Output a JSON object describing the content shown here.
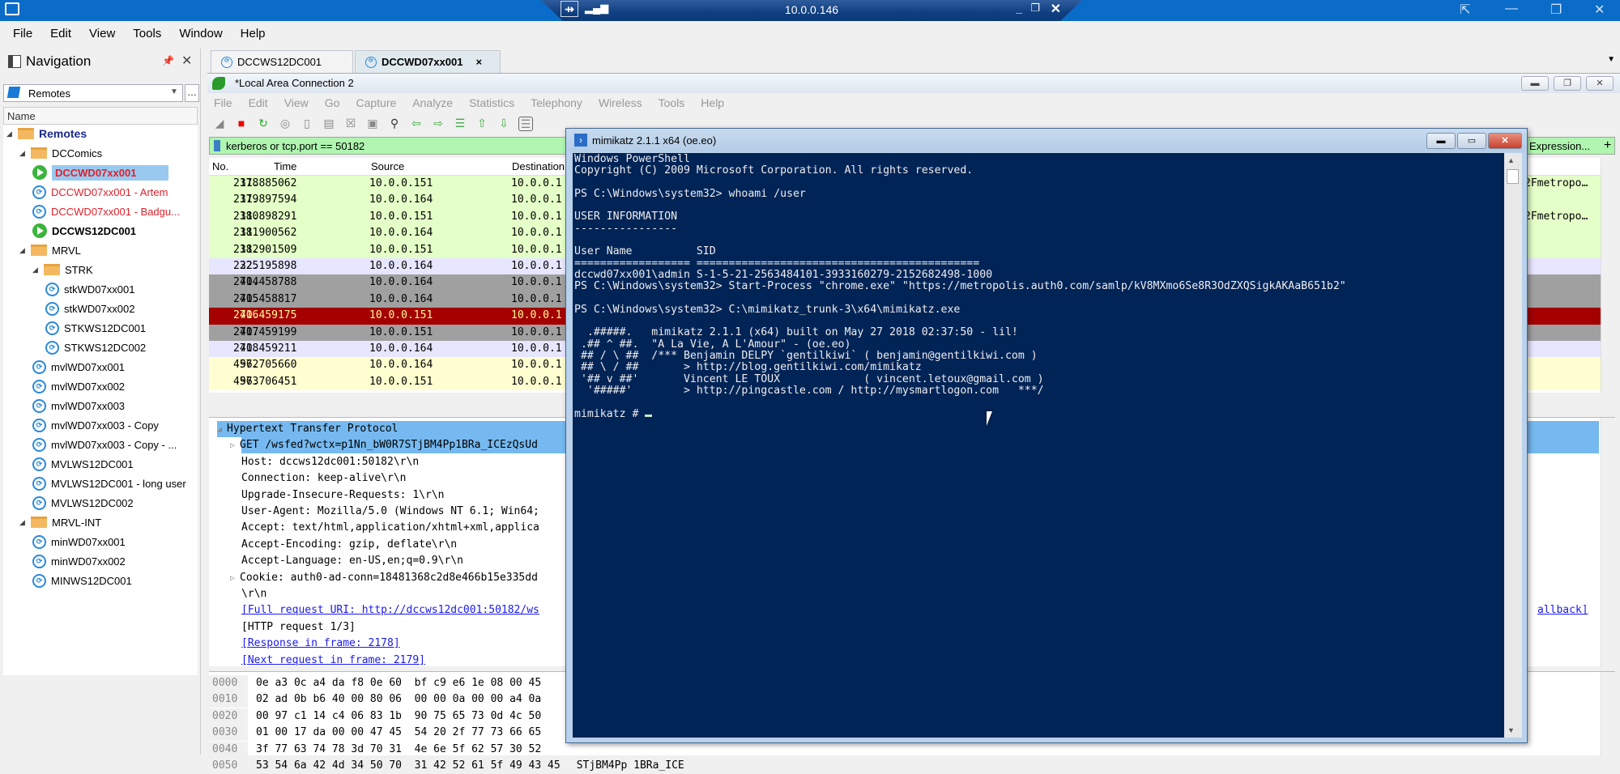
{
  "rdp_bar": {
    "title": "10.0.0.146",
    "pin_icon": "pin-icon",
    "signal_icon": "signal-bars-icon"
  },
  "app": {
    "menu": [
      "File",
      "Edit",
      "View",
      "Tools",
      "Window",
      "Help"
    ]
  },
  "navigation": {
    "title": "Navigation",
    "selector_value": "Remotes",
    "column_header": "Name",
    "tree": [
      {
        "label": "Remotes",
        "type": "root-folder",
        "level": 0,
        "style": "bold navy"
      },
      {
        "label": "DCComics",
        "type": "folder",
        "level": 1
      },
      {
        "label": "DCCWD07xx001",
        "type": "connected",
        "level": 2,
        "style": "bold red",
        "selected": true
      },
      {
        "label": "DCCWD07xx001 - Artem",
        "type": "rdp",
        "level": 2,
        "style": "red"
      },
      {
        "label": "DCCWD07xx001 - Badgu...",
        "type": "rdp",
        "level": 2,
        "style": "red"
      },
      {
        "label": "DCCWS12DC001",
        "type": "connected",
        "level": 2,
        "style": "bold"
      },
      {
        "label": "MRVL",
        "type": "folder",
        "level": 1
      },
      {
        "label": "STRK",
        "type": "folder",
        "level": 2
      },
      {
        "label": "stkWD07xx001",
        "type": "rdp",
        "level": 3
      },
      {
        "label": "stkWD07xx002",
        "type": "rdp",
        "level": 3
      },
      {
        "label": "STKWS12DC001",
        "type": "rdp",
        "level": 3
      },
      {
        "label": "STKWS12DC002",
        "type": "rdp",
        "level": 3
      },
      {
        "label": "mvlWD07xx001",
        "type": "rdp",
        "level": 2
      },
      {
        "label": "mvlWD07xx002",
        "type": "rdp",
        "level": 2
      },
      {
        "label": "mvlWD07xx003",
        "type": "rdp",
        "level": 2
      },
      {
        "label": "mvlWD07xx003 - Copy",
        "type": "rdp",
        "level": 2
      },
      {
        "label": "mvlWD07xx003 - Copy - ...",
        "type": "rdp",
        "level": 2
      },
      {
        "label": "MVLWS12DC001",
        "type": "rdp",
        "level": 2
      },
      {
        "label": "MVLWS12DC001 - long user",
        "type": "rdp",
        "level": 2
      },
      {
        "label": "MVLWS12DC002",
        "type": "rdp",
        "level": 2
      },
      {
        "label": "MRVL-INT",
        "type": "folder",
        "level": 1
      },
      {
        "label": "minWD07xx001",
        "type": "rdp",
        "level": 2
      },
      {
        "label": "minWD07xx002",
        "type": "rdp",
        "level": 2
      },
      {
        "label": "MINWS12DC001",
        "type": "rdp",
        "level": 2
      }
    ]
  },
  "doc_tabs": [
    {
      "label": "DCCWS12DC001",
      "active": false
    },
    {
      "label": "DCCWD07xx001",
      "active": true,
      "close": "×"
    }
  ],
  "wireshark": {
    "title": "*Local Area Connection 2",
    "menu": [
      "File",
      "Edit",
      "View",
      "Go",
      "Capture",
      "Analyze",
      "Statistics",
      "Telephony",
      "Wireless",
      "Tools",
      "Help"
    ],
    "filter": "kerberos or tcp.port == 50182",
    "expression_label": "Expression...",
    "add_label": "+",
    "columns": [
      "No.",
      "Time",
      "Source",
      "Destination"
    ],
    "packets": [
      {
        "no": "2178",
        "time": "31.885062",
        "src": "10.0.0.151",
        "dst": "10.0.0.1",
        "color": "green",
        "extra": "2Fmetropo…"
      },
      {
        "no": "2179",
        "time": "31.897594",
        "src": "10.0.0.164",
        "dst": "10.0.0.1",
        "color": "green",
        "extra": ""
      },
      {
        "no": "2180",
        "time": "31.898291",
        "src": "10.0.0.151",
        "dst": "10.0.0.1",
        "color": "green",
        "extra": "2Fmetropo…"
      },
      {
        "no": "2181",
        "time": "31.900562",
        "src": "10.0.0.164",
        "dst": "10.0.0.1",
        "color": "green",
        "extra": ""
      },
      {
        "no": "2182",
        "time": "31.901509",
        "src": "10.0.0.151",
        "dst": "10.0.0.1",
        "color": "green",
        "extra": ""
      },
      {
        "no": "2225",
        "time": "32.195898",
        "src": "10.0.0.164",
        "dst": "10.0.0.1",
        "color": "lav",
        "extra": ""
      },
      {
        "no": "2714",
        "time": "40.458788",
        "src": "10.0.0.164",
        "dst": "10.0.0.1",
        "color": "gray",
        "extra": ""
      },
      {
        "no": "2715",
        "time": "40.458817",
        "src": "10.0.0.164",
        "dst": "10.0.0.1",
        "color": "gray",
        "extra": ""
      },
      {
        "no": "2716",
        "time": "40.459175",
        "src": "10.0.0.151",
        "dst": "10.0.0.1",
        "color": "red",
        "extra": ""
      },
      {
        "no": "2717",
        "time": "40.459199",
        "src": "10.0.0.151",
        "dst": "10.0.0.1",
        "color": "gray",
        "extra": ""
      },
      {
        "no": "2718",
        "time": "40.459211",
        "src": "10.0.0.164",
        "dst": "10.0.0.1",
        "color": "lav",
        "extra": ""
      },
      {
        "no": "4572",
        "time": "96.705660",
        "src": "10.0.0.164",
        "dst": "10.0.0.1",
        "color": "yel",
        "extra": ""
      },
      {
        "no": "4573",
        "time": "96.706451",
        "src": "10.0.0.151",
        "dst": "10.0.0.1",
        "color": "yel",
        "extra": ""
      }
    ],
    "details": [
      {
        "text": "Hypertext Transfer Protocol",
        "indent": 0,
        "expander": "◢",
        "selected": true
      },
      {
        "text": "GET /wsfed?wctx=p1Nn_bW0R7STjBM4Pp1BRa_ICEzQsUd",
        "indent": 1,
        "expander": "▷",
        "selected": true
      },
      {
        "text": "Host: dccws12dc001:50182\\r\\n",
        "indent": 1
      },
      {
        "text": "Connection: keep-alive\\r\\n",
        "indent": 1
      },
      {
        "text": "Upgrade-Insecure-Requests: 1\\r\\n",
        "indent": 1
      },
      {
        "text": "User-Agent: Mozilla/5.0 (Windows NT 6.1; Win64;",
        "indent": 1
      },
      {
        "text": "Accept: text/html,application/xhtml+xml,applica",
        "indent": 1
      },
      {
        "text": "Accept-Encoding: gzip, deflate\\r\\n",
        "indent": 1
      },
      {
        "text": "Accept-Language: en-US,en;q=0.9\\r\\n",
        "indent": 1
      },
      {
        "text": "Cookie: auth0-ad-conn=18481368c2d8e466b15e335dd",
        "indent": 1,
        "expander": "▷"
      },
      {
        "text": "\\r\\n",
        "indent": 1
      },
      {
        "text": "[Full request URI: http://dccws12dc001:50182/ws",
        "indent": 1,
        "link": true,
        "tail": "allback]"
      },
      {
        "text": "[HTTP request 1/3]",
        "indent": 1
      },
      {
        "text": "[Response in frame: 2178]",
        "indent": 1,
        "link": true
      },
      {
        "text": "[Next request in frame: 2179]",
        "indent": 1,
        "link": true
      }
    ],
    "hex": [
      {
        "offset": "0000",
        "bytes": "0e a3 0c a4 da f8 0e 60  bf c9 e6 1e 08 00 45",
        "ascii": ""
      },
      {
        "offset": "0010",
        "bytes": "02 ad 0b b6 40 00 80 06  00 00 0a 00 00 a4 0a",
        "ascii": ""
      },
      {
        "offset": "0020",
        "bytes": "00 97 c1 14 c4 06 83 1b  90 75 65 73 0d 4c 50",
        "ascii": ""
      },
      {
        "offset": "0030",
        "bytes": "01 00 17 da 00 00 47 45  54 20 2f 77 73 66 65",
        "ascii": ""
      },
      {
        "offset": "0040",
        "bytes": "3f 77 63 74 78 3d 70 31  4e 6e 5f 62 57 30 52",
        "ascii": ""
      },
      {
        "offset": "0050",
        "bytes": "53 54 6a 42 4d 34 50 70  31 42 52 61 5f 49 43 45",
        "ascii": "STjBM4Pp 1BRa_ICE"
      }
    ]
  },
  "powershell": {
    "title": "mimikatz 2.1.1 x64 (oe.eo)",
    "lines": [
      "Windows PowerShell",
      "Copyright (C) 2009 Microsoft Corporation. All rights reserved.",
      "",
      "PS C:\\Windows\\system32> whoami /user",
      "",
      "USER INFORMATION",
      "----------------",
      "",
      "User Name          SID",
      "================== ============================================",
      "dccwd07xx001\\admin S-1-5-21-2563484101-3933160279-2152682498-1000",
      "PS C:\\Windows\\system32> Start-Process \"chrome.exe\" \"https://metropolis.auth0.com/samlp/kV8MXmo6Se8R3OdZXQSigkAKAaB651b2\"",
      "",
      "PS C:\\Windows\\system32> C:\\mimikatz_trunk-3\\x64\\mimikatz.exe",
      "",
      "  .#####.   mimikatz 2.1.1 (x64) built on May 27 2018 02:37:50 - lil!",
      " .## ^ ##.  \"A La Vie, A L'Amour\" - (oe.eo)",
      " ## / \\ ##  /*** Benjamin DELPY `gentilkiwi` ( benjamin@gentilkiwi.com )",
      " ## \\ / ##       > http://blog.gentilkiwi.com/mimikatz",
      " '## v ##'       Vincent LE TOUX             ( vincent.letoux@gmail.com )",
      "  '#####'        > http://pingcastle.com / http://mysmartlogon.com   ***/",
      ""
    ],
    "prompt": "mimikatz # "
  }
}
